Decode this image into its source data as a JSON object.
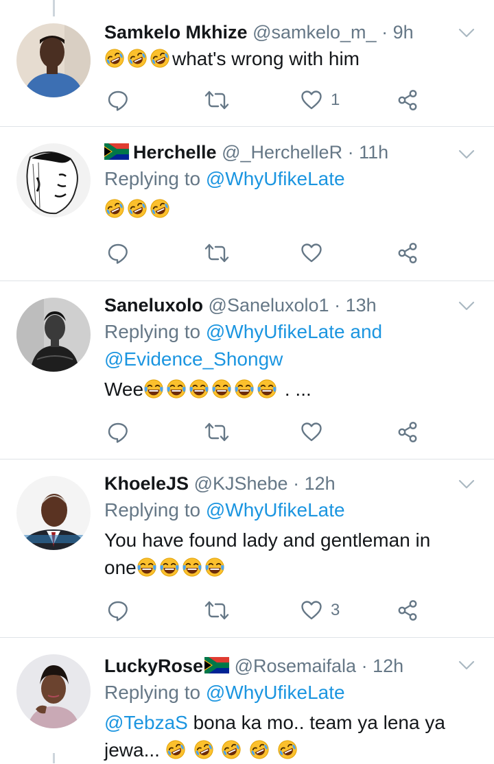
{
  "colors": {
    "link": "#1b95e0",
    "secondary": "#657786",
    "text": "#14171a",
    "divider": "#dfe3e7"
  },
  "tweets": [
    {
      "name": "Samkelo Mkhize",
      "handle": "@samkelo_m_",
      "time": "· 9h",
      "flag": "",
      "text_emoji": [
        "rofl",
        "rofl",
        "rofl"
      ],
      "text": "what's wrong with him",
      "like_count": "1"
    },
    {
      "name": "Herchelle",
      "handle": "@_HerchelleR",
      "time": "· 11h",
      "flag": "south-africa-flag",
      "replying_label": "Replying to",
      "replying_to": "@WhyUfikeLate",
      "text_emoji": [
        "rofl",
        "rofl",
        "rofl"
      ],
      "like_count": ""
    },
    {
      "name": "Saneluxolo",
      "handle": "@Saneluxolo1",
      "time": "· 13h",
      "replying_label": "Replying to",
      "replying_to": "@WhyUfikeLate",
      "replying_and": "and",
      "replying_to_2": "@Evidence_Shongw",
      "text_prefix": "Wee",
      "text_emoji": [
        "joy",
        "joy",
        "joy",
        "joy",
        "joy",
        "joy"
      ],
      "text_suffix": ". ...",
      "like_count": ""
    },
    {
      "name": "KhoeleJS",
      "handle": "@KJShebe",
      "time": "· 12h",
      "replying_label": "Replying to",
      "replying_to": "@WhyUfikeLate",
      "text_line1": "You have found lady  and gentleman in",
      "text_line2": "one",
      "text_emoji": [
        "joy",
        "joy",
        "joy",
        "joy"
      ],
      "like_count": "3"
    },
    {
      "name": "LuckyRose",
      "handle": "@Rosemaifala",
      "time": "· 12h",
      "flag": "south-africa-flag",
      "replying_label": "Replying to",
      "replying_to": "@WhyUfikeLate",
      "mention": "@TebzaS",
      "text_line1": " bona ka mo.. team ya lena ya",
      "text_line2": "jewa...",
      "text_emoji": [
        "rofl",
        "rofl",
        "rofl",
        "rofl",
        "rofl"
      ]
    }
  ]
}
